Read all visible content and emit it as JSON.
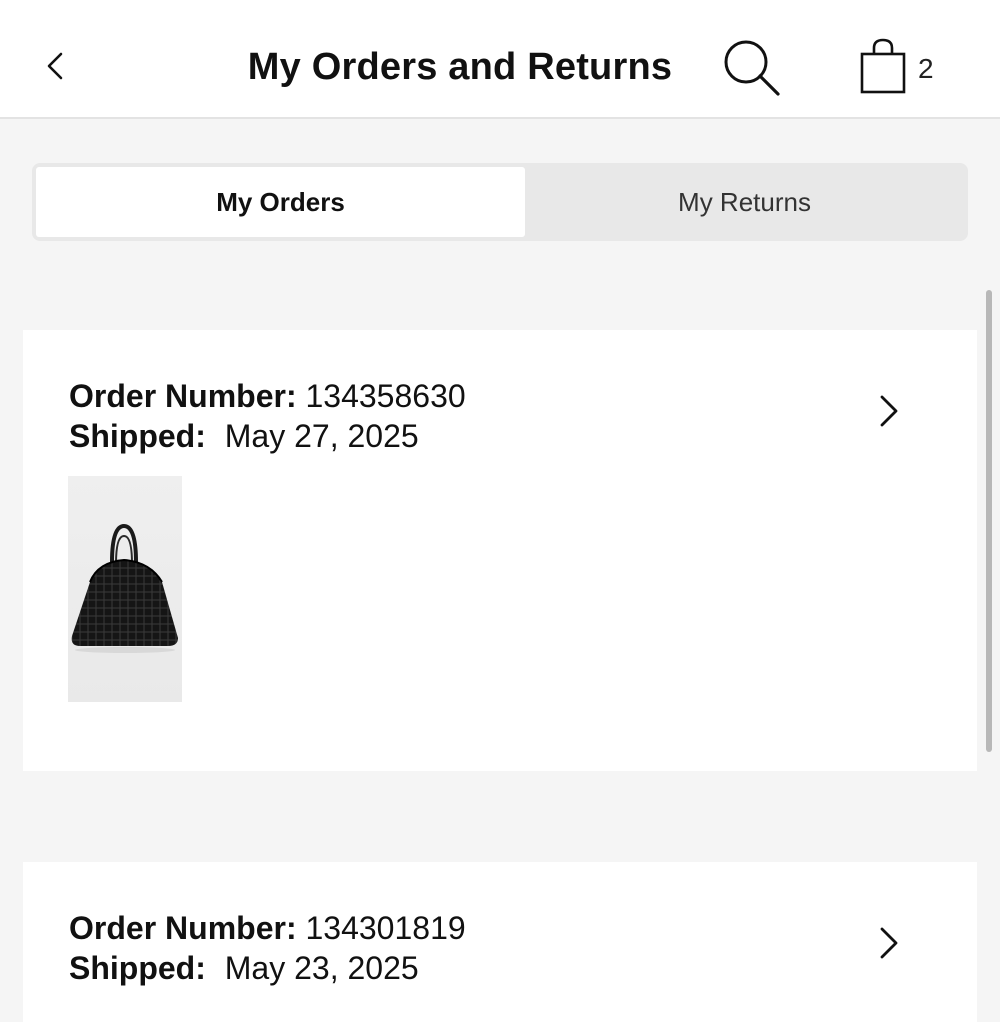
{
  "header": {
    "title": "My Orders and Returns",
    "back_icon": "chevron-left-icon",
    "search_icon": "search-icon",
    "bag_icon": "shopping-bag-icon",
    "bag_count": "2"
  },
  "tabs": [
    {
      "label": "My Orders",
      "active": true
    },
    {
      "label": "My Returns",
      "active": false
    }
  ],
  "orders": [
    {
      "order_label": "Order Number:",
      "order_number": "134358630",
      "status_label": "Shipped:",
      "status_date": "May 27, 2025",
      "product_image": "black-woven-tote-bag"
    },
    {
      "order_label": "Order Number:",
      "order_number": "134301819",
      "status_label": "Shipped:",
      "status_date": "May 23, 2025"
    }
  ],
  "colors": {
    "background": "#f5f5f5",
    "card": "#ffffff",
    "tab_track": "#e8e8e8",
    "text": "#111111"
  }
}
